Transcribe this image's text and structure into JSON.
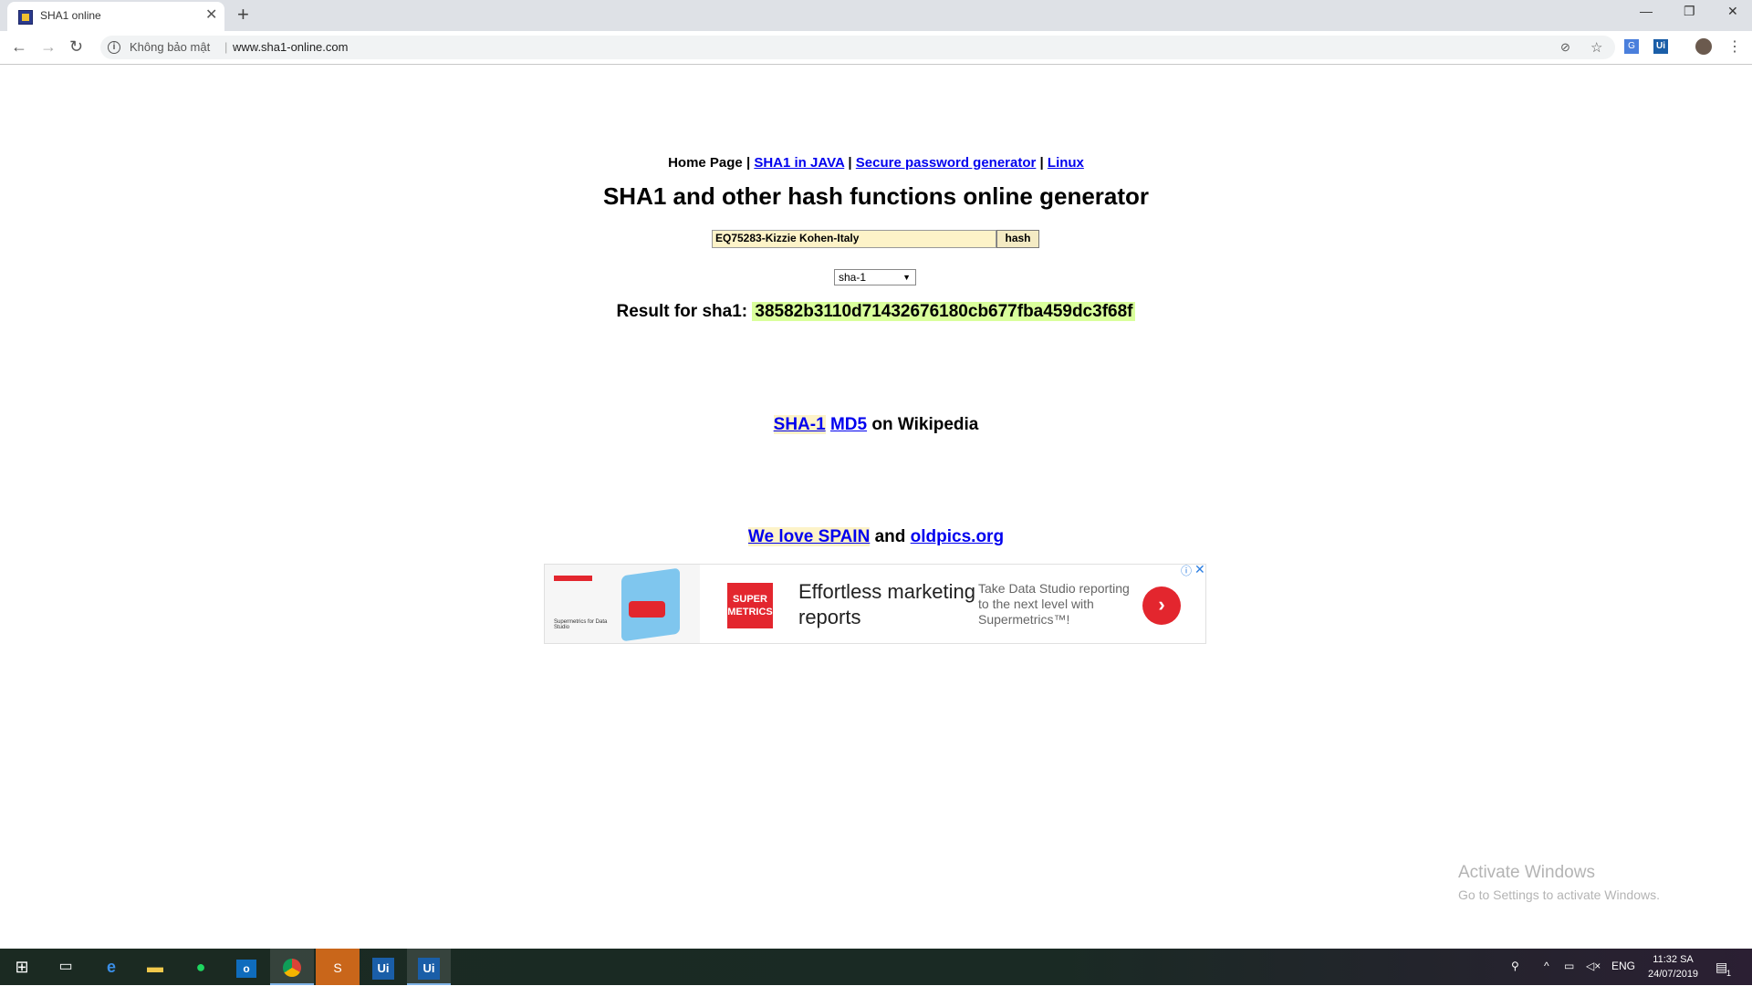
{
  "browser": {
    "tab_title": "SHA1 online",
    "insecure_label": "Không bảo mật",
    "url": "www.sha1-online.com"
  },
  "nav": {
    "home": "Home Page",
    "sha1_java": "SHA1 in JAVA",
    "password_gen": "Secure password generator",
    "linux": "Linux",
    "separator": "|"
  },
  "page": {
    "title": "SHA1 and other hash functions online generator",
    "input_value": "EQ75283-Kizzie Kohen-Italy",
    "hash_button": "hash",
    "algorithm_selected": "sha-1",
    "result_label": "Result for sha1:",
    "result_value": "38582b3110d71432676180cb677fba459dc3f68f",
    "wiki_sha1": "SHA-1",
    "wiki_md5": "MD5",
    "wiki_suffix": "on Wikipedia",
    "spain_link": "We love SPAIN",
    "and_text": "and",
    "oldpics_link": "oldpics.org"
  },
  "ad": {
    "thumb_caption": "Supermetrics for Data Studio",
    "logo_text": "SUPER METRICS",
    "headline": "Effortless marketing reports",
    "body": "Take Data Studio reporting to the next level with Supermetrics™!"
  },
  "watermark": {
    "line1": "Activate Windows",
    "line2": "Go to Settings to activate Windows."
  },
  "taskbar": {
    "language": "ENG",
    "time": "11:32 SA",
    "date": "24/07/2019",
    "notification_count": "1"
  }
}
